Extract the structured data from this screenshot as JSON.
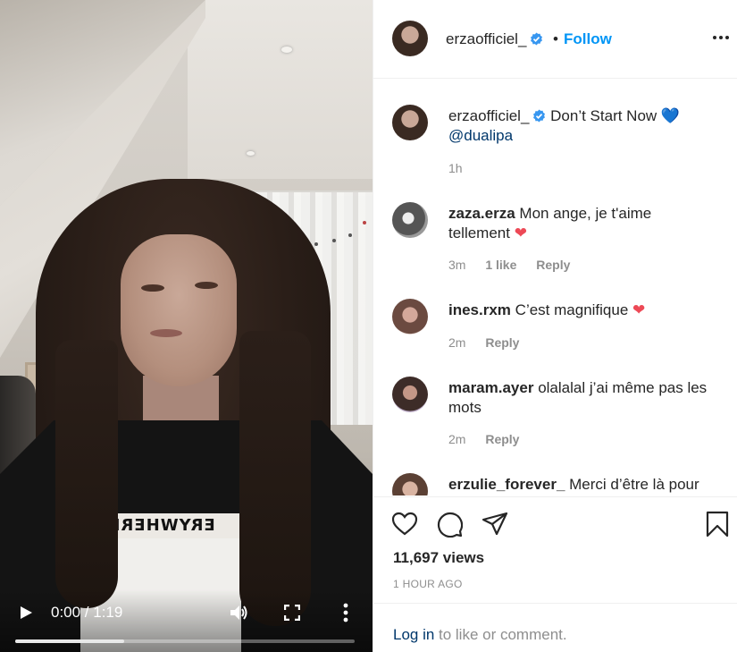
{
  "video": {
    "shirt_print": "ERYWHERE",
    "time_display": "0:00 / 1:19",
    "progress": 0.32
  },
  "post": {
    "username": "erzaofficiel_",
    "follow_separator": "•",
    "follow_label": "Follow",
    "caption_text": "Don’t Start Now",
    "caption_emoji": "💙",
    "caption_mention": "@dualipa",
    "caption_age": "1h"
  },
  "comments": [
    {
      "user": "zaza.erza",
      "text": "Mon ange, je t'aime tellement",
      "emoji": "❤",
      "age": "3m",
      "likes": "1 like",
      "reply": "Reply"
    },
    {
      "user": "ines.rxm",
      "text": "C’est magnifique",
      "emoji": "❤",
      "age": "2m",
      "likes": "",
      "reply": "Reply"
    },
    {
      "user": "maram.ayer",
      "text": "olalalal j’ai même pas les mots",
      "emoji": "",
      "age": "2m",
      "likes": "",
      "reply": "Reply"
    },
    {
      "user": "erzulie_forever_",
      "text": "Merci d’être là pour",
      "emoji": "",
      "age": "",
      "likes": "",
      "reply": ""
    }
  ],
  "engagement": {
    "views": "11,697 views",
    "time_ago": "1 HOUR AGO"
  },
  "login": {
    "link": "Log in",
    "rest": "to like or comment."
  },
  "icons": {
    "heart": "heart-icon",
    "comment": "comment-icon",
    "share": "share-icon",
    "save": "bookmark-icon",
    "verified": "verified-badge-icon",
    "more": "more-options-icon"
  },
  "colors": {
    "accent": "#0095f6",
    "mention": "#00376b",
    "muted": "#8e8e8e",
    "heart_red": "#ed4956",
    "heart_blue": "#3897f0"
  }
}
